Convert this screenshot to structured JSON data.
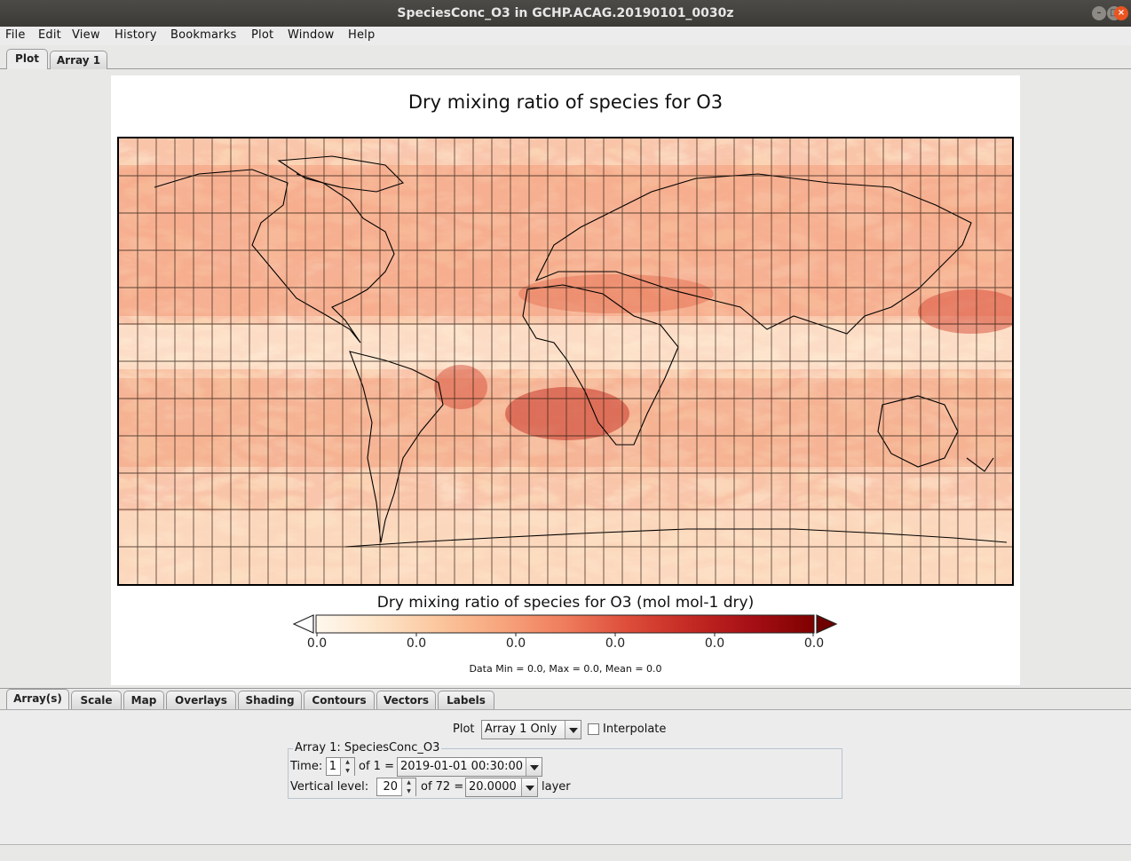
{
  "window": {
    "title": "SpeciesConc_O3 in GCHP.ACAG.20190101_0030z"
  },
  "menu": [
    "File",
    "Edit",
    "View",
    "History",
    "Bookmarks",
    "Plot",
    "Window",
    "Help"
  ],
  "top_tabs": [
    "Plot",
    "Array 1"
  ],
  "plot": {
    "title": "Dry mixing ratio of species for O3",
    "colorbar": {
      "title": "Dry mixing ratio of species for O3 (mol mol-1 dry)",
      "ticks": [
        "0.0",
        "0.0",
        "0.0",
        "0.0",
        "0.0",
        "0.0"
      ],
      "colors": [
        "#fff8ee",
        "#fde4c8",
        "#fbc59c",
        "#f7a47c",
        "#ef7c5c",
        "#dd4d3a",
        "#c42a23",
        "#a50f15",
        "#7f0000"
      ]
    },
    "stats": "Data Min = 0.0, Max = 0.0, Mean = 0.0"
  },
  "bottom_tabs": [
    "Array(s)",
    "Scale",
    "Map",
    "Overlays",
    "Shading",
    "Contours",
    "Vectors",
    "Labels"
  ],
  "controls": {
    "plot_label": "Plot",
    "plot_mode": "Array 1 Only",
    "interpolate_label": "Interpolate",
    "group_title": "Array 1: SpeciesConc_O3",
    "time_label": "Time:",
    "time_index": "1",
    "time_of": "of 1 =",
    "time_value": "2019-01-01 00:30:00",
    "level_label": "Vertical level:",
    "level_index": "20",
    "level_of": "of 72 =",
    "level_value": "20.0000",
    "level_unit": "layer"
  }
}
